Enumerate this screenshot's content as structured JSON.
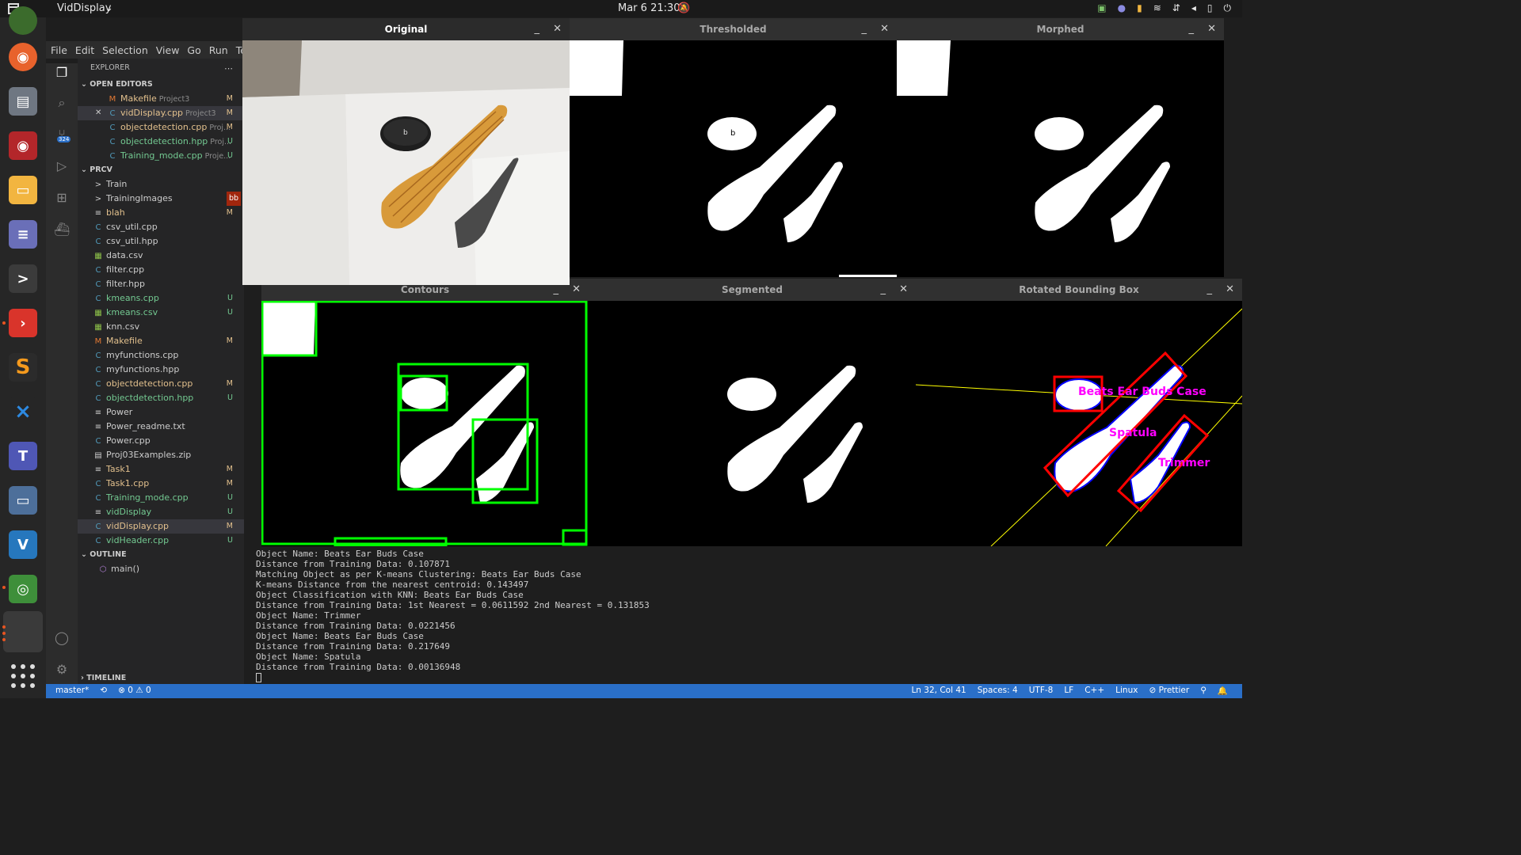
{
  "topbar": {
    "app_name": "VidDisplay",
    "clock": "Mar 6  21:30"
  },
  "vscode": {
    "menu": [
      "File",
      "Edit",
      "Selection",
      "View",
      "Go",
      "Run",
      "Term"
    ],
    "explorer_title": "EXPLORER",
    "scm_badge": "324",
    "open_editors_title": "OPEN EDITORS",
    "open_editors": [
      {
        "icon": "M",
        "name": "Makefile",
        "project": "Project3",
        "status": "M",
        "color": "orange"
      },
      {
        "icon": "C",
        "name": "vidDisplay.cpp",
        "project": "Project3",
        "status": "M",
        "color": "orange",
        "selected": true
      },
      {
        "icon": "C",
        "name": "objectdetection.cpp",
        "project": "Proj...",
        "status": "M",
        "color": "orange"
      },
      {
        "icon": "C",
        "name": "objectdetection.hpp",
        "project": "Proj...",
        "status": "U",
        "color": "green"
      },
      {
        "icon": "C",
        "name": "Training_mode.cpp",
        "project": "Proje...",
        "status": "U",
        "color": "green"
      }
    ],
    "folder_title": "PRCV",
    "files": [
      {
        "icon": ">",
        "name": "Train",
        "status": "",
        "color": "plain"
      },
      {
        "icon": ">",
        "name": "TrainingImages",
        "status": "bb",
        "color": "plain"
      },
      {
        "icon": "≡",
        "name": "blah",
        "status": "M",
        "color": "orange"
      },
      {
        "icon": "C",
        "name": "csv_util.cpp",
        "status": "",
        "color": "plain"
      },
      {
        "icon": "C",
        "name": "csv_util.hpp",
        "status": "",
        "color": "plain"
      },
      {
        "icon": "▦",
        "name": "data.csv",
        "status": "",
        "color": "plain"
      },
      {
        "icon": "C",
        "name": "filter.cpp",
        "status": "",
        "color": "plain"
      },
      {
        "icon": "C",
        "name": "filter.hpp",
        "status": "",
        "color": "plain"
      },
      {
        "icon": "C",
        "name": "kmeans.cpp",
        "status": "U",
        "color": "green"
      },
      {
        "icon": "▦",
        "name": "kmeans.csv",
        "status": "U",
        "color": "green"
      },
      {
        "icon": "▦",
        "name": "knn.csv",
        "status": "",
        "color": "plain"
      },
      {
        "icon": "M",
        "name": "Makefile",
        "status": "M",
        "color": "orange"
      },
      {
        "icon": "C",
        "name": "myfunctions.cpp",
        "status": "",
        "color": "plain"
      },
      {
        "icon": "C",
        "name": "myfunctions.hpp",
        "status": "",
        "color": "plain"
      },
      {
        "icon": "C",
        "name": "objectdetection.cpp",
        "status": "M",
        "color": "orange"
      },
      {
        "icon": "C",
        "name": "objectdetection.hpp",
        "status": "U",
        "color": "green"
      },
      {
        "icon": "≡",
        "name": "Power",
        "status": "",
        "color": "plain"
      },
      {
        "icon": "≡",
        "name": "Power_readme.txt",
        "status": "",
        "color": "plain"
      },
      {
        "icon": "C",
        "name": "Power.cpp",
        "status": "",
        "color": "plain"
      },
      {
        "icon": "▤",
        "name": "Proj03Examples.zip",
        "status": "",
        "color": "plain"
      },
      {
        "icon": "≡",
        "name": "Task1",
        "status": "M",
        "color": "orange"
      },
      {
        "icon": "C",
        "name": "Task1.cpp",
        "status": "M",
        "color": "orange"
      },
      {
        "icon": "C",
        "name": "Training_mode.cpp",
        "status": "U",
        "color": "green"
      },
      {
        "icon": "≡",
        "name": "vidDisplay",
        "status": "U",
        "color": "green"
      },
      {
        "icon": "C",
        "name": "vidDisplay.cpp",
        "status": "M",
        "color": "orange",
        "selected": true
      },
      {
        "icon": "C",
        "name": "vidHeader.cpp",
        "status": "U",
        "color": "green"
      }
    ],
    "outline_title": "OUTLINE",
    "outline_item": "main()",
    "timeline_title": "TIMELINE",
    "terminal_lines": [
      "Object Name: Beats Ear Buds Case",
      "Distance from Training Data: 0.107871",
      "Matching Object as per K-means Clustering: Beats Ear Buds Case",
      "K-means Distance from the nearest centroid: 0.143497",
      "Object Classification with KNN: Beats Ear Buds Case",
      "Distance from Training Data: 1st Nearest = 0.0611592 2nd Nearest = 0.131853",
      "Object Name: Trimmer",
      "Distance from Training Data: 0.0221456",
      "Object Name: Beats Ear Buds Case",
      "Distance from Training Data: 0.217649",
      "Object Name: Spatula",
      "Distance from Training Data: 0.00136948"
    ],
    "status_left": [
      "master*",
      "⟲",
      "⊗ 0 ⚠ 0"
    ],
    "status_right": [
      "Ln 32, Col 41",
      "Spaces: 4",
      "UTF-8",
      "LF",
      "C++",
      "Linux",
      "⊘ Prettier",
      "⚲",
      "🔔"
    ]
  },
  "windows": {
    "original": "Original",
    "thresholded": "Thresholded",
    "morphed": "Morphed",
    "contours": "Contours",
    "segmented": "Segmented",
    "rotated": "Rotated Bounding Box"
  },
  "labels": {
    "case_letter": "b",
    "case_label": "Beats Ear Buds Case",
    "spatula_label": "Spatula",
    "trimmer_label": "Trimmer"
  },
  "colors": {
    "contour_green": "#00ff00",
    "bbox_red": "#ff0000",
    "label_magenta": "#ff00ff",
    "axis_yellow": "#ffff00",
    "vscode_blue": "#2a6fc8"
  }
}
